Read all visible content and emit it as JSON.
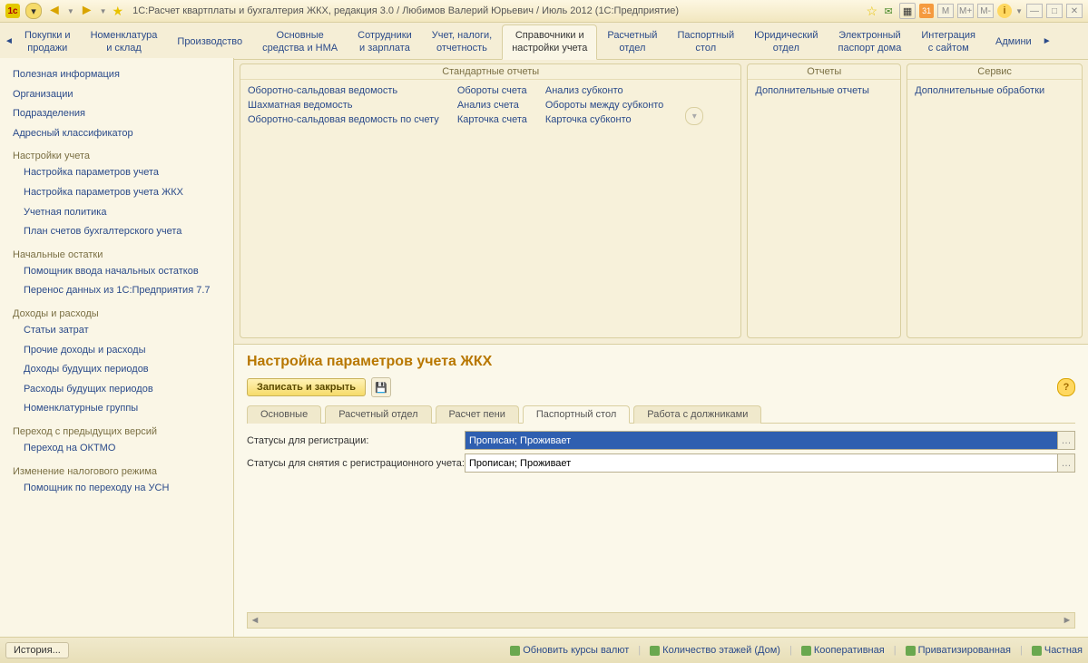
{
  "title": "1С:Расчет квартплаты и бухгалтерия ЖКХ, редакция 3.0 / Любимов Валерий Юрьевич / Июль 2012  (1С:Предприятие)",
  "titlebar_right": [
    "M",
    "M+",
    "M-"
  ],
  "toptabs": {
    "items": [
      {
        "l1": "Покупки и",
        "l2": "продажи"
      },
      {
        "l1": "Номенклатура",
        "l2": "и склад"
      },
      {
        "l1": "Производство",
        "l2": ""
      },
      {
        "l1": "Основные",
        "l2": "средства и НМА"
      },
      {
        "l1": "Сотрудники",
        "l2": "и зарплата"
      },
      {
        "l1": "Учет, налоги,",
        "l2": "отчетность"
      },
      {
        "l1": "Справочники и",
        "l2": "настройки учета"
      },
      {
        "l1": "Расчетный",
        "l2": "отдел"
      },
      {
        "l1": "Паспортный",
        "l2": "стол"
      },
      {
        "l1": "Юридический",
        "l2": "отдел"
      },
      {
        "l1": "Электронный",
        "l2": "паспорт дома"
      },
      {
        "l1": "Интеграция",
        "l2": "с сайтом"
      },
      {
        "l1": "Админи",
        "l2": ""
      }
    ],
    "active_index": 6
  },
  "sidebar": {
    "top": [
      "Полезная информация",
      "Организации",
      "Подразделения",
      "Адресный классификатор"
    ],
    "sections": [
      {
        "title": "Настройки учета",
        "items": [
          "Настройка параметров учета",
          "Настройка параметров учета ЖКХ",
          "Учетная политика",
          "План счетов бухгалтерского учета"
        ]
      },
      {
        "title": "Начальные остатки",
        "items": [
          "Помощник ввода начальных остатков",
          "Перенос данных из 1С:Предприятия 7.7"
        ]
      },
      {
        "title": "Доходы и расходы",
        "items": [
          "Статьи затрат",
          "Прочие доходы и расходы",
          "Доходы будущих периодов",
          "Расходы будущих периодов",
          "Номенклатурные группы"
        ]
      },
      {
        "title": "Переход с предыдущих версий",
        "items": [
          "Переход на ОКТМО"
        ]
      },
      {
        "title": "Изменение налогового режима",
        "items": [
          "Помощник по переходу на УСН"
        ]
      }
    ]
  },
  "panels": {
    "p1": {
      "title": "Стандартные отчеты",
      "cols": [
        [
          "Оборотно-сальдовая ведомость",
          "Шахматная ведомость",
          "Оборотно-сальдовая ведомость по счету"
        ],
        [
          "Обороты счета",
          "Анализ счета",
          "Карточка счета"
        ],
        [
          "Анализ субконто",
          "Обороты между субконто",
          "Карточка субконто"
        ]
      ]
    },
    "p2": {
      "title": "Отчеты",
      "cols": [
        [
          "Дополнительные отчеты"
        ]
      ]
    },
    "p3": {
      "title": "Сервис",
      "cols": [
        [
          "Дополнительные обработки"
        ]
      ]
    }
  },
  "page": {
    "title": "Настройка параметров учета ЖКХ",
    "save_close": "Записать и закрыть",
    "tabs": [
      "Основные",
      "Расчетный отдел",
      "Расчет пени",
      "Паспортный стол",
      "Работа с должниками"
    ],
    "active_tab_index": 3,
    "form": {
      "row1": {
        "label": "Статусы для регистрации:",
        "value": "Прописан; Проживает"
      },
      "row2": {
        "label": "Статусы для снятия с регистрационного учета:",
        "value": "Прописан; Проживает"
      }
    }
  },
  "status": {
    "history": "История...",
    "links": [
      "Обновить курсы валют",
      "Количество этажей (Дом)",
      "Кооперативная",
      "Приватизированная",
      "Частная"
    ]
  }
}
